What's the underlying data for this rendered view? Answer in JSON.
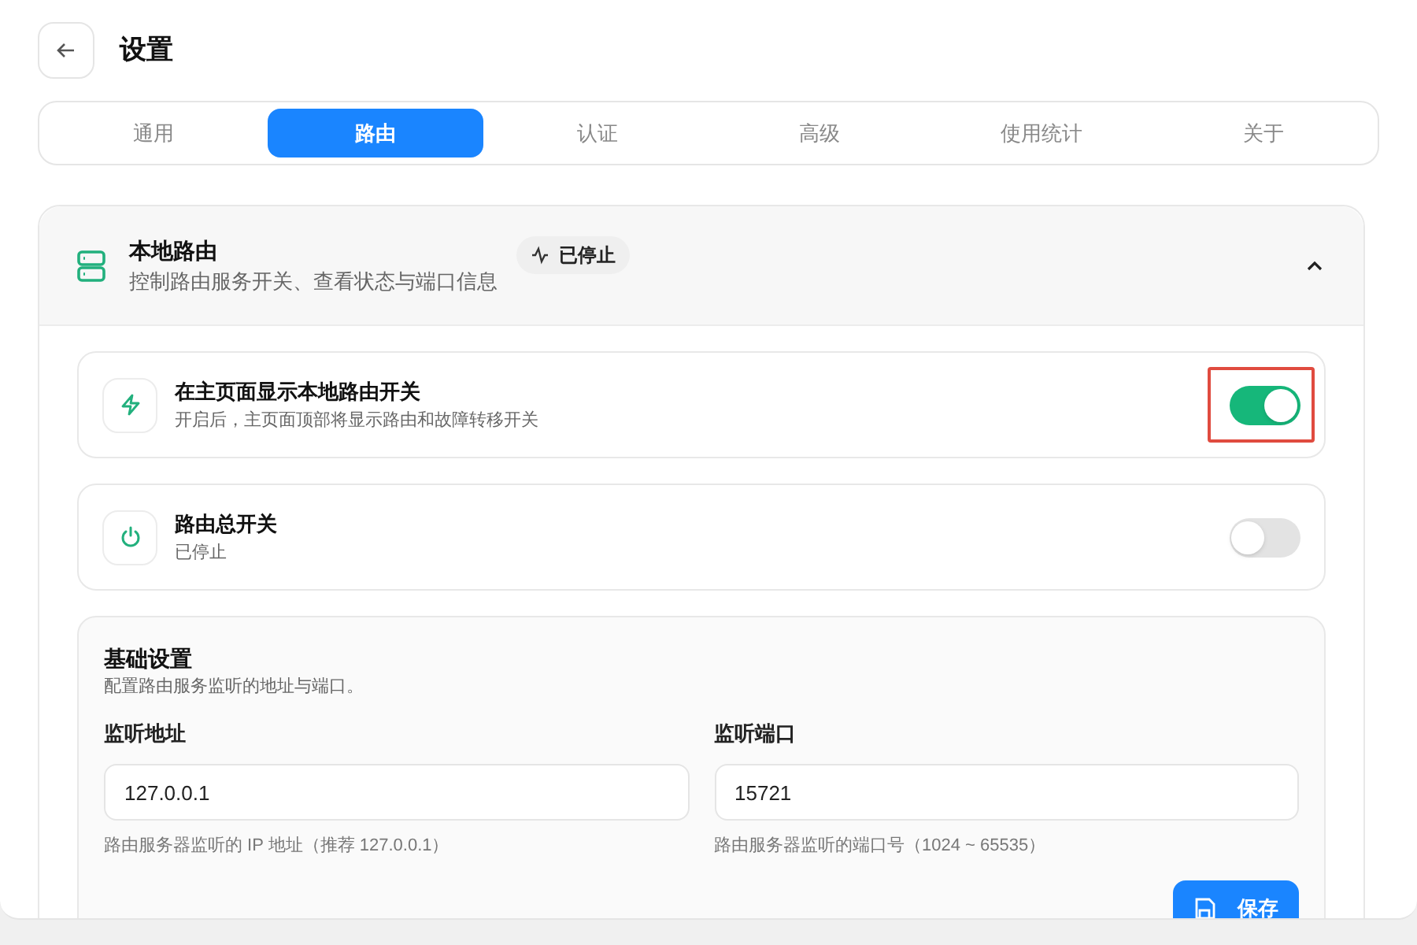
{
  "header": {
    "title": "设置"
  },
  "tabs": [
    {
      "label": "通用",
      "selected": false
    },
    {
      "label": "路由",
      "selected": true
    },
    {
      "label": "认证",
      "selected": false
    },
    {
      "label": "高级",
      "selected": false
    },
    {
      "label": "使用统计",
      "selected": false
    },
    {
      "label": "关于",
      "selected": false
    }
  ],
  "section": {
    "title": "本地路由",
    "subtitle": "控制路由服务开关、查看状态与端口信息",
    "status_badge": "已停止",
    "expanded": true,
    "settings": [
      {
        "kind": "bolt",
        "title": "在主页面显示本地路由开关",
        "description": "开启后，主页面顶部将显示路由和故障转移开关",
        "on": true,
        "highlighted": true
      },
      {
        "kind": "power",
        "title": "路由总开关",
        "description": "已停止",
        "on": false,
        "highlighted": false
      }
    ],
    "basic": {
      "title": "基础设置",
      "description": "配置路由服务监听的地址与端口。",
      "fields": [
        {
          "label": "监听地址",
          "value": "127.0.0.1",
          "hint": "路由服务器监听的 IP 地址（推荐 127.0.0.1）"
        },
        {
          "label": "监听端口",
          "value": "15721",
          "hint": "路由服务器监听的端口号（1024 ~ 65535）"
        }
      ],
      "save_button": "保存"
    }
  }
}
